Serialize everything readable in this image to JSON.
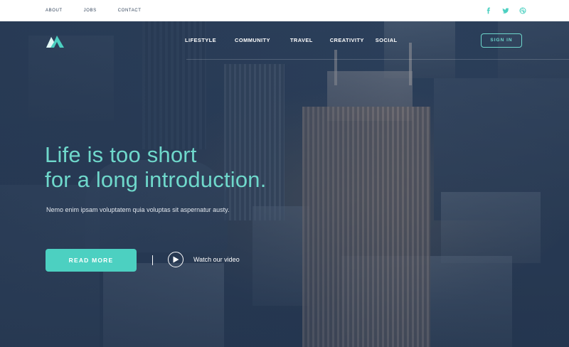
{
  "topbar": {
    "links": [
      "ABOUT",
      "JOBS",
      "CONTACT"
    ],
    "social": [
      "facebook-icon",
      "twitter-icon",
      "dribbble-icon"
    ],
    "social_color": "#4cd0c1"
  },
  "nav": {
    "items": [
      "LIFESTYLE",
      "COMMUNITY",
      "TRAVEL",
      "CREATIVITY",
      "SOCIAL"
    ],
    "signin_label": "SIGN IN"
  },
  "hero": {
    "headline_line1": "Life is too short",
    "headline_line2": "for a long introduction.",
    "subtext": "Nemo enim ipsam voluptatem quia voluptas sit aspernatur austy.",
    "read_more_label": "READ MORE",
    "watch_label": "Watch our video"
  },
  "colors": {
    "accent": "#4cd0c1",
    "headline": "#6fd8cb",
    "overlay": "#263852"
  }
}
